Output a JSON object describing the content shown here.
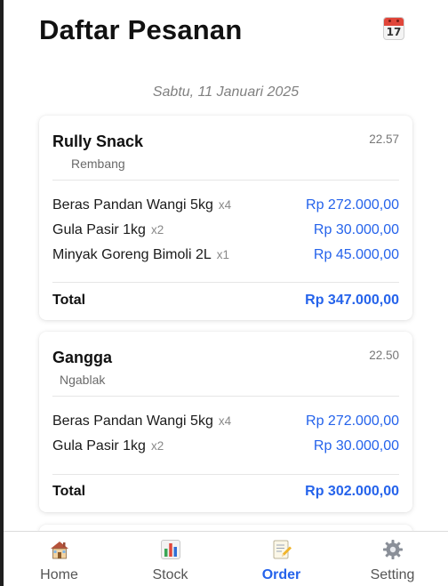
{
  "header": {
    "title": "Daftar Pesanan",
    "calendar_day": "17",
    "calendar_icon": "calendar-icon"
  },
  "date_label": "Sabtu, 11 Januari 2025",
  "orders": [
    {
      "customer": "Rully Snack",
      "location": "Rembang",
      "time": "22.57",
      "items": [
        {
          "name": "Beras Pandan Wangi 5kg",
          "qty": "x4",
          "price": "Rp 272.000,00"
        },
        {
          "name": "Gula Pasir 1kg",
          "qty": "x2",
          "price": "Rp 30.000,00"
        },
        {
          "name": "Minyak Goreng Bimoli 2L",
          "qty": "x1",
          "price": "Rp 45.000,00"
        }
      ],
      "total_label": "Total",
      "total": "Rp 347.000,00"
    },
    {
      "customer": "Gangga",
      "location": "Ngablak",
      "time": "22.50",
      "items": [
        {
          "name": "Beras Pandan Wangi 5kg",
          "qty": "x4",
          "price": "Rp 272.000,00"
        },
        {
          "name": "Gula Pasir 1kg",
          "qty": "x2",
          "price": "Rp 30.000,00"
        }
      ],
      "total_label": "Total",
      "total": "Rp 302.000,00"
    }
  ],
  "nav": {
    "items": [
      {
        "label": "Home",
        "icon": "house-icon"
      },
      {
        "label": "Stock",
        "icon": "bar-chart-icon"
      },
      {
        "label": "Order",
        "icon": "memo-icon",
        "active": true
      },
      {
        "label": "Setting",
        "icon": "gear-icon"
      }
    ]
  },
  "colors": {
    "accent": "#2563eb",
    "text": "#111111",
    "muted": "#808080"
  }
}
